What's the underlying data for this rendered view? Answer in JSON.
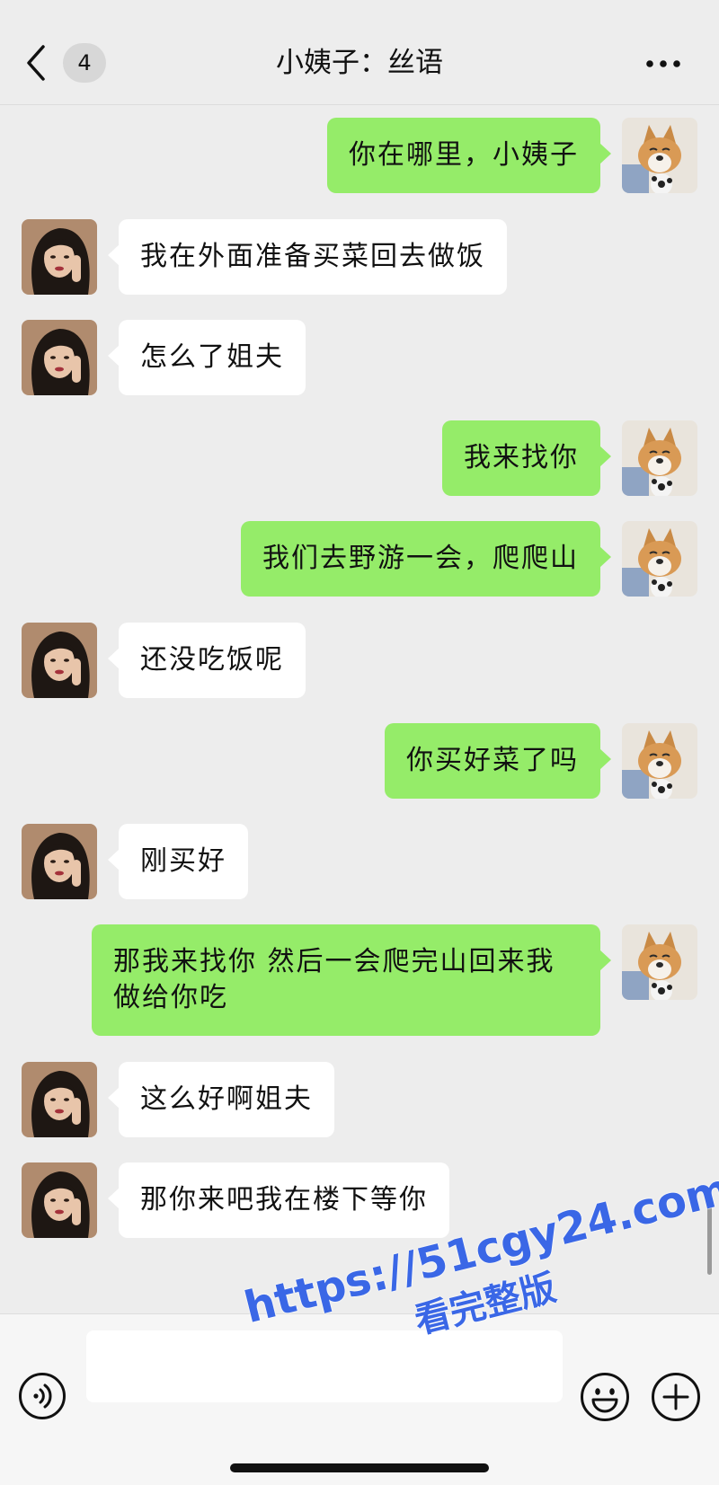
{
  "header": {
    "back_icon": "chevron-left-icon",
    "unread_count": "4",
    "title": "小姨子：丝语",
    "more_icon": "more-dots-icon"
  },
  "messages": [
    {
      "from": "me",
      "text": "你在哪里，小姨子"
    },
    {
      "from": "contact",
      "text": "我在外面准备买菜回去做饭"
    },
    {
      "from": "contact",
      "text": "怎么了姐夫"
    },
    {
      "from": "me",
      "text": "我来找你"
    },
    {
      "from": "me",
      "text": "我们去野游一会，爬爬山"
    },
    {
      "from": "contact",
      "text": "还没吃饭呢"
    },
    {
      "from": "me",
      "text": "你买好菜了吗"
    },
    {
      "from": "contact",
      "text": "刚买好"
    },
    {
      "from": "me",
      "text": "那我来找你 然后一会爬完山回来我做给你吃"
    },
    {
      "from": "contact",
      "text": "这么好啊姐夫"
    },
    {
      "from": "contact",
      "text": "那你来吧我在楼下等你"
    }
  ],
  "input_bar": {
    "voice_icon": "voice-icon",
    "input_value": "",
    "emoji_icon": "emoji-icon",
    "plus_icon": "plus-icon"
  },
  "watermark": {
    "url": "https://51cgy24.com",
    "subtitle": "看完整版"
  },
  "colors": {
    "sent_bubble": "#95ec69",
    "received_bubble": "#ffffff",
    "background": "#ededed",
    "watermark": "#3a67e6"
  }
}
